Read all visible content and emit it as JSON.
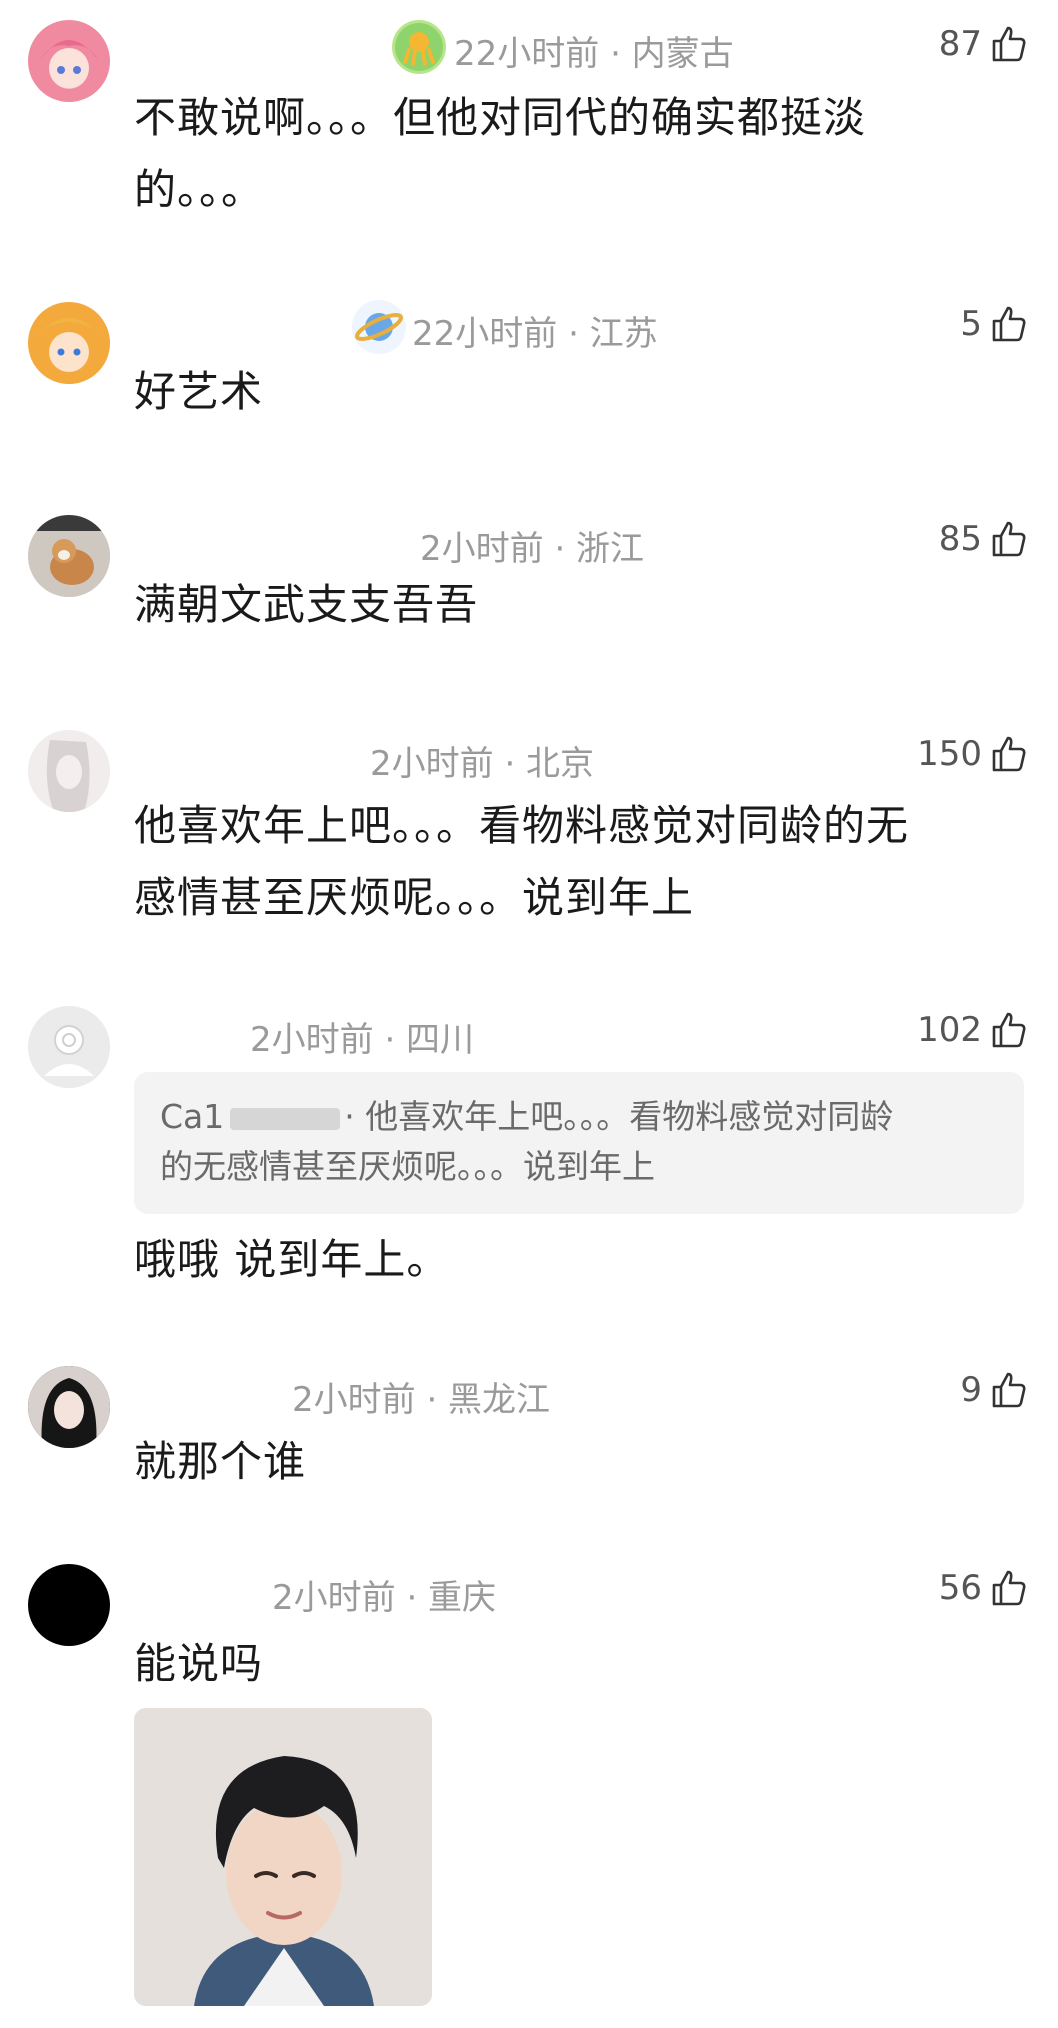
{
  "comments": [
    {
      "time_location": "22小时前 · 内蒙古",
      "likes": "87",
      "lines": [
        "不敢说啊。。。但他对同代的确实都挺淡",
        "的。。。"
      ]
    },
    {
      "time_location": "22小时前 · 江苏",
      "likes": "5",
      "lines": [
        "好艺术"
      ]
    },
    {
      "time_location": "2小时前 · 浙江",
      "likes": "85",
      "lines": [
        "满朝文武支支吾吾"
      ]
    },
    {
      "time_location": "2小时前 · 北京",
      "likes": "150",
      "lines": [
        "他喜欢年上吧。。。看物料感觉对同龄的无",
        "感情甚至厌烦呢。。。说到年上"
      ]
    },
    {
      "time_location": "2小时前 · 四川",
      "likes": "102",
      "quote": {
        "name": "Ca1",
        "lines": [
          "·  他喜欢年上吧。。。看物料感觉对同龄",
          "的无感情甚至厌烦呢。。。说到年上"
        ]
      },
      "lines": [
        "哦哦 说到年上。"
      ]
    },
    {
      "time_location": "2小时前 · 黑龙江",
      "likes": "9",
      "lines": [
        "就那个谁"
      ]
    },
    {
      "time_location": "2小时前 · 重庆",
      "likes": "56",
      "lines": [
        "能说吗"
      ]
    }
  ],
  "colors": {
    "meta_text": "#9a9a9a",
    "quote_bg": "#f3f3f3"
  },
  "icons": {
    "like": "thumbs-up-icon",
    "badge_1": "octopus-badge-icon",
    "badge_2": "planet-badge-icon"
  }
}
